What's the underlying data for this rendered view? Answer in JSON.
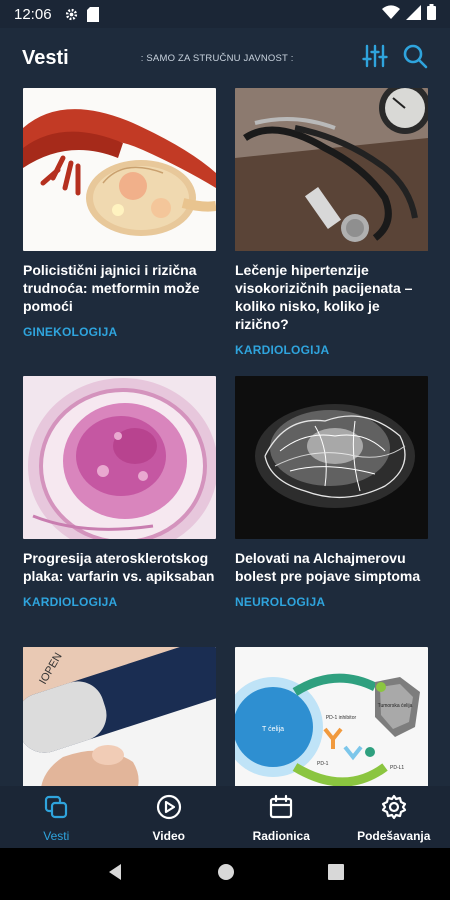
{
  "status_bar": {
    "time": "12:06",
    "icons": [
      "gear-icon",
      "sd-card-icon",
      "wifi-icon",
      "signal-icon",
      "battery-icon"
    ]
  },
  "app_bar": {
    "title": "Vesti",
    "subtitle": ": SAMO ZA STRUČNU JAVNOST :",
    "actions": [
      "filter-sliders-icon",
      "search-icon"
    ]
  },
  "articles": [
    {
      "title": "Policistični jajnici i rizična trudnoća: metformin može pomoći",
      "category": "GINEKOLOGIJA",
      "image": "ovary-illustration"
    },
    {
      "title": "Lečenje hipertenzije visokorizičnih pacijenata – koliko nisko, koliko je rizično?",
      "category": "KARDIOLOGIJA",
      "image": "stethoscope-photo"
    },
    {
      "title": "Progresija aterosklerotskog plaka: varfarin vs. apiksaban",
      "category": "KARDIOLOGIJA",
      "image": "plaque-histology"
    },
    {
      "title": "Delovati na Alchajmerovu bolest pre pojave simptoma",
      "category": "NEUROLOGIJA",
      "image": "brain-neurons"
    },
    {
      "title": "",
      "category": "",
      "image": "insulin-pen-photo"
    },
    {
      "title": "",
      "category": "",
      "image": "pd1-diagram"
    }
  ],
  "diagram_labels": {
    "t_cell": "T ćelija",
    "tumor_cell": "Tumorska ćelija",
    "pd1_inhibitor": "PD-1 inhibitor",
    "pd1": "PD-1",
    "pdl1": "PD-L1",
    "pen_text": "IOPEN"
  },
  "bottom_nav": [
    {
      "label": "Vesti",
      "icon": "news-copy-icon",
      "active": true
    },
    {
      "label": "Video",
      "icon": "play-circle-icon",
      "active": false
    },
    {
      "label": "Radionica",
      "icon": "calendar-icon",
      "active": false
    },
    {
      "label": "Podešavanja",
      "icon": "gear-settings-icon",
      "active": false
    }
  ],
  "colors": {
    "background": "#1e2b3c",
    "bars": "#1b2636",
    "accent": "#2fa4dd",
    "text": "#ffffff"
  }
}
